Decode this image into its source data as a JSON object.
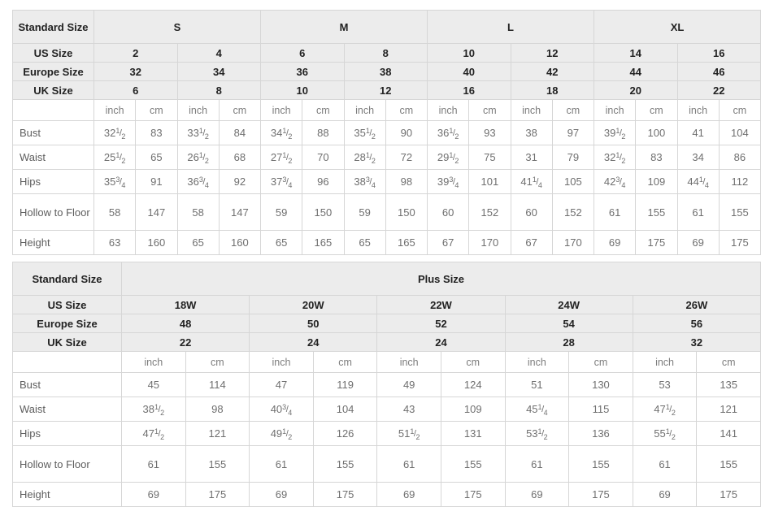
{
  "tables": [
    {
      "id": "standard-size-table",
      "label_column_header": "Standard Size",
      "size_groups": [
        {
          "label": "S",
          "span": 2
        },
        {
          "label": "M",
          "span": 2
        },
        {
          "label": "L",
          "span": 2
        },
        {
          "label": "XL",
          "span": 2
        }
      ],
      "spec_rows": [
        {
          "label": "US Size",
          "values": [
            "2",
            "4",
            "6",
            "8",
            "10",
            "12",
            "14",
            "16"
          ]
        },
        {
          "label": "Europe Size",
          "values": [
            "32",
            "34",
            "36",
            "38",
            "40",
            "42",
            "44",
            "46"
          ]
        },
        {
          "label": "UK Size",
          "values": [
            "6",
            "8",
            "10",
            "12",
            "16",
            "18",
            "20",
            "22"
          ]
        }
      ],
      "unit_row": [
        "inch",
        "cm",
        "inch",
        "cm",
        "inch",
        "cm",
        "inch",
        "cm",
        "inch",
        "cm",
        "inch",
        "cm",
        "inch",
        "cm",
        "inch",
        "cm"
      ],
      "measure_rows": [
        {
          "label": "Bust",
          "tall": false,
          "cells": [
            {
              "whole": "32",
              "num": "1",
              "den": "2"
            },
            {
              "whole": "83"
            },
            {
              "whole": "33",
              "num": "1",
              "den": "2"
            },
            {
              "whole": "84"
            },
            {
              "whole": "34",
              "num": "1",
              "den": "2"
            },
            {
              "whole": "88"
            },
            {
              "whole": "35",
              "num": "1",
              "den": "2"
            },
            {
              "whole": "90"
            },
            {
              "whole": "36",
              "num": "1",
              "den": "2"
            },
            {
              "whole": "93"
            },
            {
              "whole": "38"
            },
            {
              "whole": "97"
            },
            {
              "whole": "39",
              "num": "1",
              "den": "2"
            },
            {
              "whole": "100"
            },
            {
              "whole": "41"
            },
            {
              "whole": "104"
            }
          ]
        },
        {
          "label": "Waist",
          "tall": false,
          "cells": [
            {
              "whole": "25",
              "num": "1",
              "den": "2"
            },
            {
              "whole": "65"
            },
            {
              "whole": "26",
              "num": "1",
              "den": "2"
            },
            {
              "whole": "68"
            },
            {
              "whole": "27",
              "num": "1",
              "den": "2"
            },
            {
              "whole": "70"
            },
            {
              "whole": "28",
              "num": "1",
              "den": "2"
            },
            {
              "whole": "72"
            },
            {
              "whole": "29",
              "num": "1",
              "den": "2"
            },
            {
              "whole": "75"
            },
            {
              "whole": "31"
            },
            {
              "whole": "79"
            },
            {
              "whole": "32",
              "num": "1",
              "den": "2"
            },
            {
              "whole": "83"
            },
            {
              "whole": "34"
            },
            {
              "whole": "86"
            }
          ]
        },
        {
          "label": "Hips",
          "tall": false,
          "cells": [
            {
              "whole": "35",
              "num": "3",
              "den": "4"
            },
            {
              "whole": "91"
            },
            {
              "whole": "36",
              "num": "3",
              "den": "4"
            },
            {
              "whole": "92"
            },
            {
              "whole": "37",
              "num": "3",
              "den": "4"
            },
            {
              "whole": "96"
            },
            {
              "whole": "38",
              "num": "3",
              "den": "4"
            },
            {
              "whole": "98"
            },
            {
              "whole": "39",
              "num": "3",
              "den": "4"
            },
            {
              "whole": "101"
            },
            {
              "whole": "41",
              "num": "1",
              "den": "4"
            },
            {
              "whole": "105"
            },
            {
              "whole": "42",
              "num": "3",
              "den": "4"
            },
            {
              "whole": "109"
            },
            {
              "whole": "44",
              "num": "1",
              "den": "4"
            },
            {
              "whole": "112"
            }
          ]
        },
        {
          "label": "Hollow to Floor",
          "tall": true,
          "cells": [
            {
              "whole": "58"
            },
            {
              "whole": "147"
            },
            {
              "whole": "58"
            },
            {
              "whole": "147"
            },
            {
              "whole": "59"
            },
            {
              "whole": "150"
            },
            {
              "whole": "59"
            },
            {
              "whole": "150"
            },
            {
              "whole": "60"
            },
            {
              "whole": "152"
            },
            {
              "whole": "60"
            },
            {
              "whole": "152"
            },
            {
              "whole": "61"
            },
            {
              "whole": "155"
            },
            {
              "whole": "61"
            },
            {
              "whole": "155"
            }
          ]
        },
        {
          "label": "Height",
          "tall": false,
          "cells": [
            {
              "whole": "63"
            },
            {
              "whole": "160"
            },
            {
              "whole": "65"
            },
            {
              "whole": "160"
            },
            {
              "whole": "65"
            },
            {
              "whole": "165"
            },
            {
              "whole": "65"
            },
            {
              "whole": "165"
            },
            {
              "whole": "67"
            },
            {
              "whole": "170"
            },
            {
              "whole": "67"
            },
            {
              "whole": "170"
            },
            {
              "whole": "69"
            },
            {
              "whole": "175"
            },
            {
              "whole": "69"
            },
            {
              "whole": "175"
            }
          ]
        }
      ]
    },
    {
      "id": "plus-size-table",
      "label_column_header": "Standard Size",
      "group_title": "Plus Size",
      "spec_rows": [
        {
          "label": "US Size",
          "values": [
            "18W",
            "20W",
            "22W",
            "24W",
            "26W"
          ]
        },
        {
          "label": "Europe Size",
          "values": [
            "48",
            "50",
            "52",
            "54",
            "56"
          ]
        },
        {
          "label": "UK Size",
          "values": [
            "22",
            "24",
            "24",
            "28",
            "32"
          ]
        }
      ],
      "unit_row": [
        "inch",
        "cm",
        "inch",
        "cm",
        "inch",
        "cm",
        "inch",
        "cm",
        "inch",
        "cm"
      ],
      "measure_rows": [
        {
          "label": "Bust",
          "tall": false,
          "cells": [
            {
              "whole": "45"
            },
            {
              "whole": "114"
            },
            {
              "whole": "47"
            },
            {
              "whole": "119"
            },
            {
              "whole": "49"
            },
            {
              "whole": "124"
            },
            {
              "whole": "51"
            },
            {
              "whole": "130"
            },
            {
              "whole": "53"
            },
            {
              "whole": "135"
            }
          ]
        },
        {
          "label": "Waist",
          "tall": false,
          "cells": [
            {
              "whole": "38",
              "num": "1",
              "den": "2"
            },
            {
              "whole": "98"
            },
            {
              "whole": "40",
              "num": "3",
              "den": "4"
            },
            {
              "whole": "104"
            },
            {
              "whole": "43"
            },
            {
              "whole": "109"
            },
            {
              "whole": "45",
              "num": "1",
              "den": "4"
            },
            {
              "whole": "115"
            },
            {
              "whole": "47",
              "num": "1",
              "den": "2"
            },
            {
              "whole": "121"
            }
          ]
        },
        {
          "label": "Hips",
          "tall": false,
          "cells": [
            {
              "whole": "47",
              "num": "1",
              "den": "2"
            },
            {
              "whole": "121"
            },
            {
              "whole": "49",
              "num": "1",
              "den": "2"
            },
            {
              "whole": "126"
            },
            {
              "whole": "51",
              "num": "1",
              "den": "2"
            },
            {
              "whole": "131"
            },
            {
              "whole": "53",
              "num": "1",
              "den": "2"
            },
            {
              "whole": "136"
            },
            {
              "whole": "55",
              "num": "1",
              "den": "2"
            },
            {
              "whole": "141"
            }
          ]
        },
        {
          "label": "Hollow to Floor",
          "tall": true,
          "cells": [
            {
              "whole": "61"
            },
            {
              "whole": "155"
            },
            {
              "whole": "61"
            },
            {
              "whole": "155"
            },
            {
              "whole": "61"
            },
            {
              "whole": "155"
            },
            {
              "whole": "61"
            },
            {
              "whole": "155"
            },
            {
              "whole": "61"
            },
            {
              "whole": "155"
            }
          ]
        },
        {
          "label": "Height",
          "tall": false,
          "cells": [
            {
              "whole": "69"
            },
            {
              "whole": "175"
            },
            {
              "whole": "69"
            },
            {
              "whole": "175"
            },
            {
              "whole": "69"
            },
            {
              "whole": "175"
            },
            {
              "whole": "69"
            },
            {
              "whole": "175"
            },
            {
              "whole": "69"
            },
            {
              "whole": "175"
            }
          ]
        }
      ]
    }
  ],
  "colors": {
    "header_bg": "#ececec",
    "border": "#d6d6d6",
    "header_text": "#222222",
    "data_text": "#6f6f6f"
  }
}
